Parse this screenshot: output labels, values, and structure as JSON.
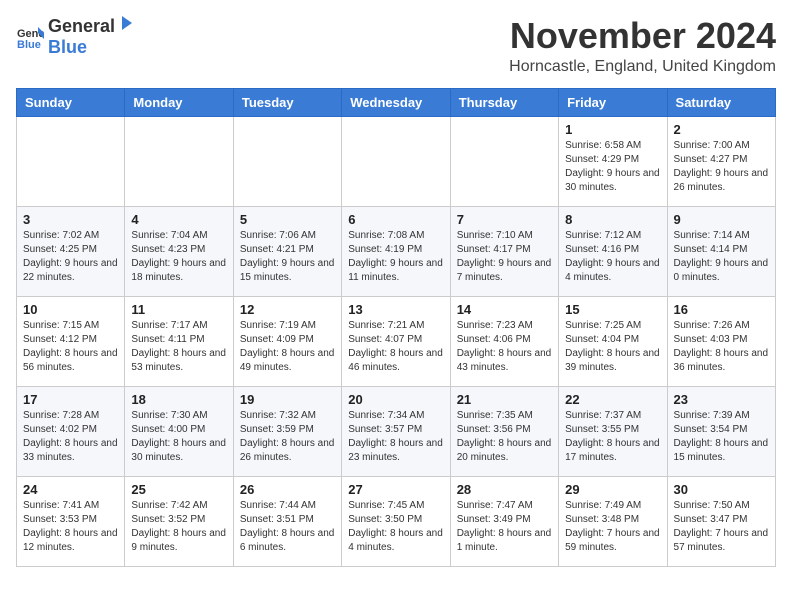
{
  "header": {
    "logo_general": "General",
    "logo_blue": "Blue",
    "month_title": "November 2024",
    "location": "Horncastle, England, United Kingdom"
  },
  "days_of_week": [
    "Sunday",
    "Monday",
    "Tuesday",
    "Wednesday",
    "Thursday",
    "Friday",
    "Saturday"
  ],
  "weeks": [
    [
      {
        "day": "",
        "info": ""
      },
      {
        "day": "",
        "info": ""
      },
      {
        "day": "",
        "info": ""
      },
      {
        "day": "",
        "info": ""
      },
      {
        "day": "",
        "info": ""
      },
      {
        "day": "1",
        "info": "Sunrise: 6:58 AM\nSunset: 4:29 PM\nDaylight: 9 hours and 30 minutes."
      },
      {
        "day": "2",
        "info": "Sunrise: 7:00 AM\nSunset: 4:27 PM\nDaylight: 9 hours and 26 minutes."
      }
    ],
    [
      {
        "day": "3",
        "info": "Sunrise: 7:02 AM\nSunset: 4:25 PM\nDaylight: 9 hours and 22 minutes."
      },
      {
        "day": "4",
        "info": "Sunrise: 7:04 AM\nSunset: 4:23 PM\nDaylight: 9 hours and 18 minutes."
      },
      {
        "day": "5",
        "info": "Sunrise: 7:06 AM\nSunset: 4:21 PM\nDaylight: 9 hours and 15 minutes."
      },
      {
        "day": "6",
        "info": "Sunrise: 7:08 AM\nSunset: 4:19 PM\nDaylight: 9 hours and 11 minutes."
      },
      {
        "day": "7",
        "info": "Sunrise: 7:10 AM\nSunset: 4:17 PM\nDaylight: 9 hours and 7 minutes."
      },
      {
        "day": "8",
        "info": "Sunrise: 7:12 AM\nSunset: 4:16 PM\nDaylight: 9 hours and 4 minutes."
      },
      {
        "day": "9",
        "info": "Sunrise: 7:14 AM\nSunset: 4:14 PM\nDaylight: 9 hours and 0 minutes."
      }
    ],
    [
      {
        "day": "10",
        "info": "Sunrise: 7:15 AM\nSunset: 4:12 PM\nDaylight: 8 hours and 56 minutes."
      },
      {
        "day": "11",
        "info": "Sunrise: 7:17 AM\nSunset: 4:11 PM\nDaylight: 8 hours and 53 minutes."
      },
      {
        "day": "12",
        "info": "Sunrise: 7:19 AM\nSunset: 4:09 PM\nDaylight: 8 hours and 49 minutes."
      },
      {
        "day": "13",
        "info": "Sunrise: 7:21 AM\nSunset: 4:07 PM\nDaylight: 8 hours and 46 minutes."
      },
      {
        "day": "14",
        "info": "Sunrise: 7:23 AM\nSunset: 4:06 PM\nDaylight: 8 hours and 43 minutes."
      },
      {
        "day": "15",
        "info": "Sunrise: 7:25 AM\nSunset: 4:04 PM\nDaylight: 8 hours and 39 minutes."
      },
      {
        "day": "16",
        "info": "Sunrise: 7:26 AM\nSunset: 4:03 PM\nDaylight: 8 hours and 36 minutes."
      }
    ],
    [
      {
        "day": "17",
        "info": "Sunrise: 7:28 AM\nSunset: 4:02 PM\nDaylight: 8 hours and 33 minutes."
      },
      {
        "day": "18",
        "info": "Sunrise: 7:30 AM\nSunset: 4:00 PM\nDaylight: 8 hours and 30 minutes."
      },
      {
        "day": "19",
        "info": "Sunrise: 7:32 AM\nSunset: 3:59 PM\nDaylight: 8 hours and 26 minutes."
      },
      {
        "day": "20",
        "info": "Sunrise: 7:34 AM\nSunset: 3:57 PM\nDaylight: 8 hours and 23 minutes."
      },
      {
        "day": "21",
        "info": "Sunrise: 7:35 AM\nSunset: 3:56 PM\nDaylight: 8 hours and 20 minutes."
      },
      {
        "day": "22",
        "info": "Sunrise: 7:37 AM\nSunset: 3:55 PM\nDaylight: 8 hours and 17 minutes."
      },
      {
        "day": "23",
        "info": "Sunrise: 7:39 AM\nSunset: 3:54 PM\nDaylight: 8 hours and 15 minutes."
      }
    ],
    [
      {
        "day": "24",
        "info": "Sunrise: 7:41 AM\nSunset: 3:53 PM\nDaylight: 8 hours and 12 minutes."
      },
      {
        "day": "25",
        "info": "Sunrise: 7:42 AM\nSunset: 3:52 PM\nDaylight: 8 hours and 9 minutes."
      },
      {
        "day": "26",
        "info": "Sunrise: 7:44 AM\nSunset: 3:51 PM\nDaylight: 8 hours and 6 minutes."
      },
      {
        "day": "27",
        "info": "Sunrise: 7:45 AM\nSunset: 3:50 PM\nDaylight: 8 hours and 4 minutes."
      },
      {
        "day": "28",
        "info": "Sunrise: 7:47 AM\nSunset: 3:49 PM\nDaylight: 8 hours and 1 minute."
      },
      {
        "day": "29",
        "info": "Sunrise: 7:49 AM\nSunset: 3:48 PM\nDaylight: 7 hours and 59 minutes."
      },
      {
        "day": "30",
        "info": "Sunrise: 7:50 AM\nSunset: 3:47 PM\nDaylight: 7 hours and 57 minutes."
      }
    ]
  ]
}
